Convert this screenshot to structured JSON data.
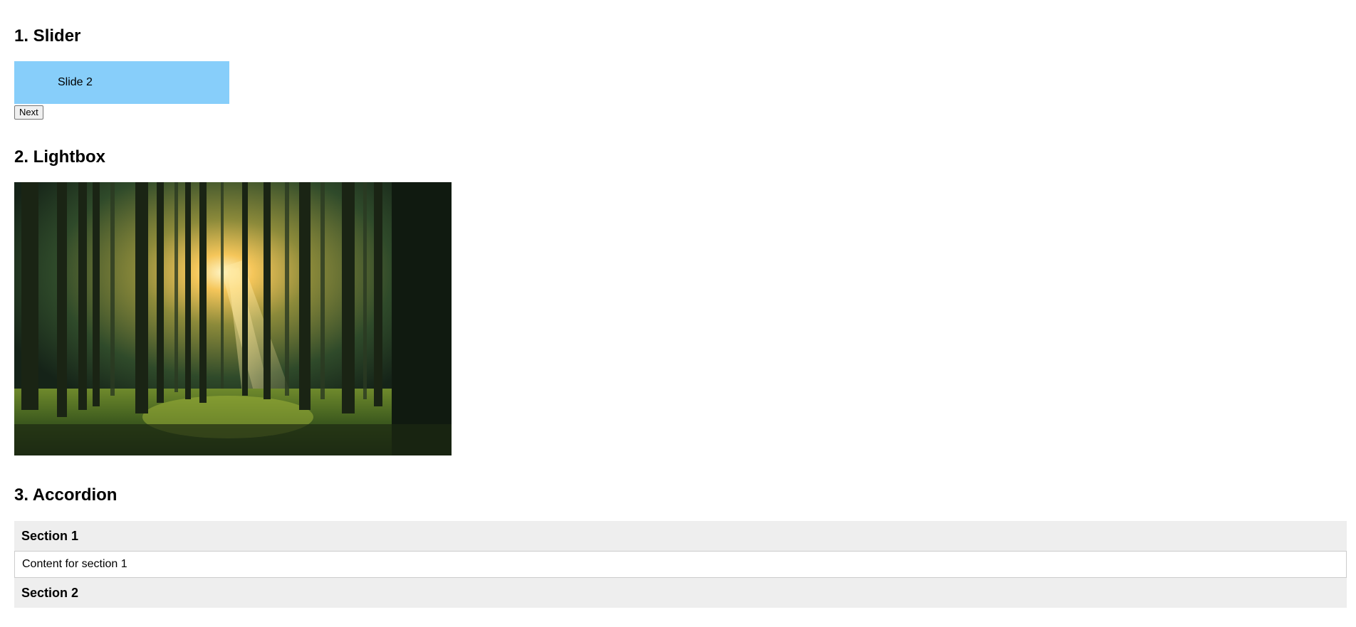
{
  "sections": {
    "slider": {
      "title": "1. Slider",
      "current_slide_label": "Slide 2",
      "next_button_label": "Next",
      "slide_color": "#87cefa"
    },
    "lightbox": {
      "title": "2. Lightbox",
      "image_subject": "sunlit pine forest"
    },
    "accordion": {
      "title": "3. Accordion",
      "items": [
        {
          "header": "Section 1",
          "content": "Content for section 1",
          "expanded": true
        },
        {
          "header": "Section 2",
          "content": "",
          "expanded": false
        }
      ]
    }
  }
}
